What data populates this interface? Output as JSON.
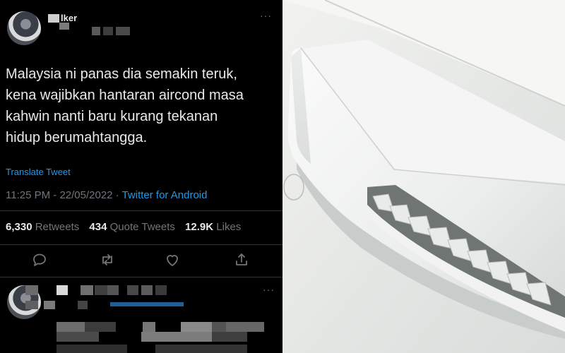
{
  "tweet": {
    "author_handle_partial": "lker",
    "text_lines": [
      "Malaysia ni panas dia semakin teruk,",
      "kena wajibkan hantaran aircond masa",
      "kahwin nanti baru kurang tekanan",
      "hidup berumahtangga."
    ],
    "translate_label": "Translate Tweet",
    "time": "11:25 PM",
    "separator": " · ",
    "date": "22/05/2022",
    "source": "Twitter for Android",
    "stats": {
      "retweets": "6,330",
      "retweets_label": "Retweets",
      "quotes": "434",
      "quotes_label": "Quote Tweets",
      "likes": "12.9K",
      "likes_label": "Likes"
    },
    "more_glyph": "···"
  },
  "actions": [
    "reply-icon",
    "retweet-icon",
    "like-icon",
    "share-icon"
  ],
  "colors": {
    "background": "#000000",
    "text": "#e7e9ea",
    "muted": "#71767b",
    "accent": "#1d9bf0",
    "divider": "#2f3336"
  },
  "photo": {
    "subject": "wall-mounted air conditioner"
  }
}
